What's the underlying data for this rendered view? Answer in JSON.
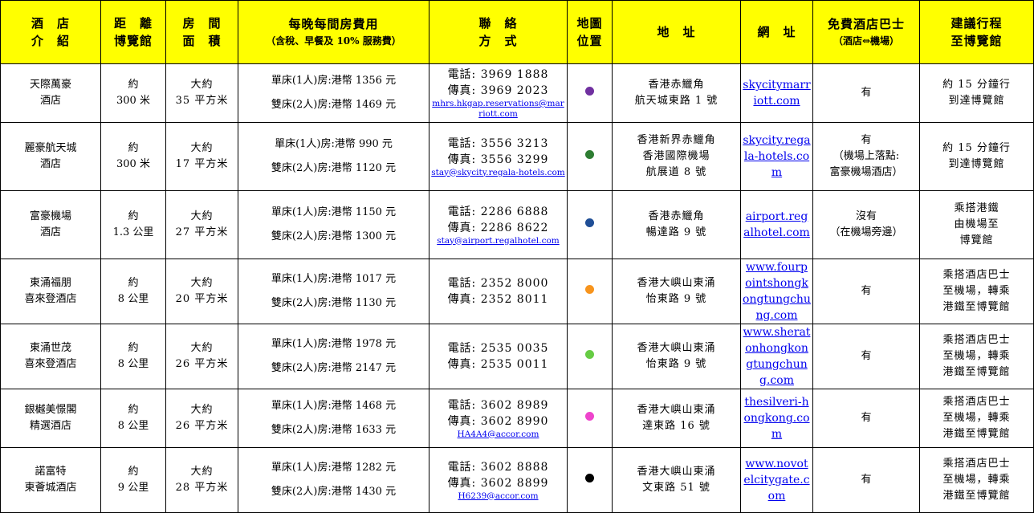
{
  "headers": {
    "hotel": [
      "酒　店",
      "介　紹"
    ],
    "distance": [
      "距　離",
      "博覽館"
    ],
    "room_area": [
      "房　間",
      "面　積"
    ],
    "rate_title": "每晚每間房費用",
    "rate_sub": "（含稅、早餐及 10% 服務費）",
    "contact": [
      "聯　絡",
      "方　式"
    ],
    "map": [
      "地圖",
      "位置"
    ],
    "address": "地　址",
    "website": "網　址",
    "shuttle_title": "免費酒店巴士",
    "shuttle_sub": "（酒店⇔機場）",
    "itinerary": [
      "建議行程",
      "至博覽館"
    ]
  },
  "rows": [
    {
      "hotel": [
        "天際萬豪",
        "酒店"
      ],
      "distance": [
        "約",
        "300 米"
      ],
      "area": [
        "大約",
        "35 平方米"
      ],
      "single": "單床(1人)房:港幣 1356 元",
      "double": "雙床(2人)房:港幣 1469 元",
      "tel": "電話: 3969 1888",
      "fax": "傳真: 3969 2023",
      "email": "mhrs.hkgap.reservations@marriott.com",
      "dot_color": "#7030a0",
      "address": [
        "香港赤鱲角",
        "航天城東路 1 號"
      ],
      "website": "skycitymarriott.com",
      "shuttle": [
        "有"
      ],
      "itinerary": [
        "約 15 分鐘行",
        "到達博覽館"
      ]
    },
    {
      "hotel": [
        "麗豪航天城",
        "酒店"
      ],
      "distance": [
        "約",
        "300 米"
      ],
      "area": [
        "大約",
        "17 平方米"
      ],
      "single": "單床(1人)房:港幣 990 元",
      "double": "雙床(2人)房:港幣 1120 元",
      "tel": "電話: 3556 3213",
      "fax": "傳真: 3556 3299",
      "email": "stay@skycity.regala-hotels.com",
      "dot_color": "#2e7d32",
      "address": [
        "香港新界赤鱲角",
        "香港國際機場",
        "航展道 8 號"
      ],
      "website": "skycity.regala-hotels.com",
      "shuttle": [
        "有",
        "（機場上落點:",
        "富豪機場酒店）"
      ],
      "itinerary": [
        "約 15 分鐘行",
        "到達博覽館"
      ]
    },
    {
      "hotel": [
        "富豪機場",
        "酒店"
      ],
      "distance": [
        "約",
        "1.3 公里"
      ],
      "area": [
        "大約",
        "27 平方米"
      ],
      "single": "單床(1人)房:港幣 1150 元",
      "double": "雙床(2人)房:港幣 1300 元",
      "tel": "電話: 2286 6888",
      "fax": "傳真: 2286 8622",
      "email": "stay@airport.regalhotel.com",
      "dot_color": "#1f4e96",
      "address": [
        "香港赤鱲角",
        "暢達路 9 號"
      ],
      "website": "airport.regalhotel.com",
      "shuttle": [
        "沒有",
        "（在機場旁邊）"
      ],
      "itinerary": [
        "乘搭港鐵",
        "由機場至",
        "博覽館"
      ]
    },
    {
      "hotel": [
        "東涌福朋",
        "喜來登酒店"
      ],
      "distance": [
        "約",
        "8 公里"
      ],
      "area": [
        "大約",
        "20 平方米"
      ],
      "single": "單床(1人)房:港幣 1017 元",
      "double": "雙床(2人)房:港幣 1130 元",
      "tel": "電話: 2352 8000",
      "fax": "傳真: 2352 8011",
      "email": "",
      "dot_color": "#f7941d",
      "address": [
        "香港大嶼山東涌",
        "怡東路 9 號"
      ],
      "website": "www.fourpointshongkongtungchung.com",
      "shuttle": [
        "有"
      ],
      "itinerary": [
        "乘搭酒店巴士",
        "至機場，轉乘",
        "港鐵至博覽館"
      ]
    },
    {
      "hotel": [
        "東涌世茂",
        "喜來登酒店"
      ],
      "distance": [
        "約",
        "8 公里"
      ],
      "area": [
        "大約",
        "26 平方米"
      ],
      "single": "單床(1人)房:港幣 1978 元",
      "double": "雙床(2人)房:港幣 2147 元",
      "tel": "電話: 2535 0035",
      "fax": "傳真: 2535 0011",
      "email": "",
      "dot_color": "#66cc44",
      "address": [
        "香港大嶼山東涌",
        "怡東路 9 號"
      ],
      "website": "www.sheratonhongkongtungchung.com",
      "shuttle": [
        "有"
      ],
      "itinerary": [
        "乘搭酒店巴士",
        "至機場，轉乘",
        "港鐵至博覽館"
      ]
    },
    {
      "hotel": [
        "銀樾美憬閣",
        "精選酒店"
      ],
      "distance": [
        "約",
        "8 公里"
      ],
      "area": [
        "大約",
        "26 平方米"
      ],
      "single": "單床(1人)房:港幣 1468 元",
      "double": "雙床(2人)房:港幣 1633 元",
      "tel": "電話: 3602 8989",
      "fax": "傳真: 3602 8990",
      "email": "HA4A4@accor.com",
      "dot_color": "#ee44cc",
      "address": [
        "香港大嶼山東涌",
        "達東路 16 號"
      ],
      "website": "thesilveri-hongkong.com",
      "shuttle": [
        "有"
      ],
      "itinerary": [
        "乘搭酒店巴士",
        "至機場，轉乘",
        "港鐵至博覽館"
      ]
    },
    {
      "hotel": [
        "諾富特",
        "東薈城酒店"
      ],
      "distance": [
        "約",
        "9 公里"
      ],
      "area": [
        "大約",
        "28 平方米"
      ],
      "single": "單床(1人)房:港幣 1282 元",
      "double": "雙床(2人)房:港幣 1430 元",
      "tel": "電話: 3602 8888",
      "fax": "傳真: 3602 8899",
      "email": "H6239@accor.com",
      "dot_color": "#000000",
      "address": [
        "香港大嶼山東涌",
        "文東路 51 號"
      ],
      "website": "www.novotelcitygate.com",
      "shuttle": [
        "有"
      ],
      "itinerary": [
        "乘搭酒店巴士",
        "至機場，轉乘",
        "港鐵至博覽館"
      ]
    }
  ]
}
